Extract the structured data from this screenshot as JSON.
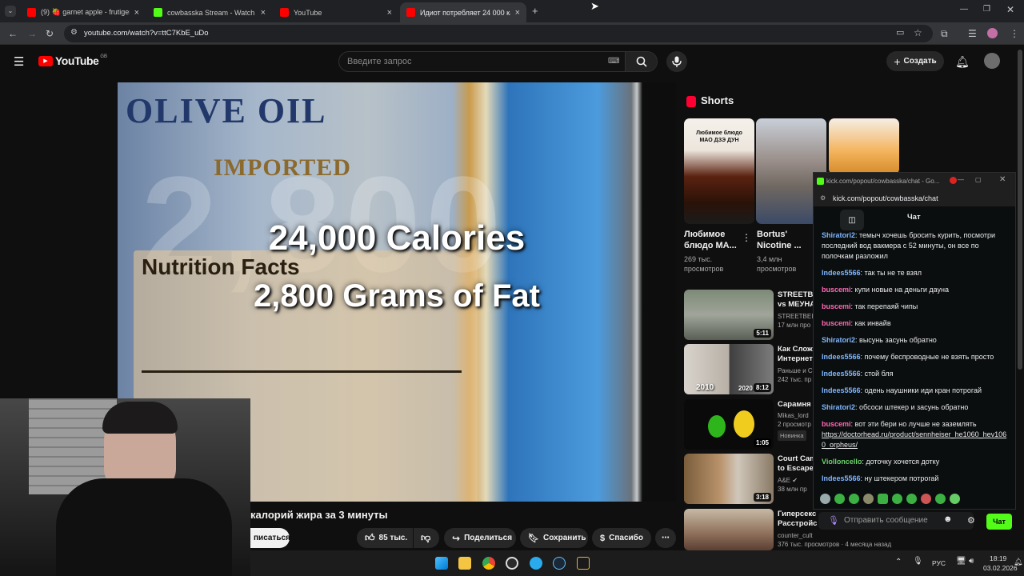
{
  "browser": {
    "tabs": [
      {
        "title": "(9) 🍓 garnet apple - frutiger a",
        "active": false
      },
      {
        "title": "cowbasska Stream - Watch Live",
        "active": false
      },
      {
        "title": "YouTube",
        "active": false
      },
      {
        "title": "Идиот потребляет 24 000 кал",
        "active": true
      }
    ],
    "new_tab": "+",
    "url": "youtube.com/watch?v=ttC7KbE_uDo"
  },
  "youtube": {
    "logo": "YouTube",
    "region": "GB",
    "search_placeholder": "Введите запрос",
    "create_label": "Создать",
    "video_overlay": {
      "line1": "24,000 Calories",
      "line2": "2,800 Grams of Fat",
      "label_top": "OLIVE OIL",
      "label_imported": "IMPORTED",
      "label_facts": "Nutrition Facts"
    },
    "video_title_fragment": "калорий жира за 3 минуты",
    "subscribe_fragment": "писаться",
    "actions": {
      "likes": "85 тыс.",
      "share": "Поделиться",
      "save": "Сохранить",
      "thanks": "Спасибо"
    },
    "shorts_heading": "Shorts",
    "shorts": [
      {
        "title_line1": "Любимое",
        "title_line2": "блюдо МА...",
        "views_line1": "269 тыс.",
        "views_line2": "просмотров",
        "thumb_text": "Любимое блюдо МАО ДЗЭ ДУН"
      },
      {
        "title_line1": "Bortus'",
        "title_line2": "Nicotine ...",
        "views_line1": "3,4 млн",
        "views_line2": "просмотров"
      }
    ],
    "recommended": [
      {
        "title1": "STREETBE",
        "title2": "vs МЕУНА",
        "meta1": "STREETBEI",
        "meta2": "17 млн про",
        "duration": "5:11"
      },
      {
        "title1": "Как Слож",
        "title2": "Интернет-",
        "meta1": "Раньше и С",
        "meta2": "242 тыс. пр",
        "duration": "8:12",
        "thumb_year": "2010",
        "thumb_year2": "2020"
      },
      {
        "title1": "Сарамня",
        "title2": "",
        "meta1": "Mikas_lord",
        "meta2": "2 просмотр",
        "badge": "Новинка",
        "duration": "1:05"
      },
      {
        "title1": "Court Cam",
        "title2": "to Escape",
        "meta1": "A&E",
        "meta2": "38 млн пр",
        "duration": "3:18"
      },
      {
        "title1": "Гиперсекс",
        "title2": "Расстройс",
        "meta1": "counter_cult",
        "meta2": "376 тыс. просмотров · 4 месяца назад"
      }
    ]
  },
  "chat_popup": {
    "window_title": "kick.com/popout/cowbasska/chat - Go...",
    "address": "kick.com/popout/cowbasska/chat",
    "tab_label": "Чат",
    "messages": [
      {
        "user": "Shiratori2",
        "color": "#7fb6ff",
        "text": "темыч хочешь бросить курить, посмотри последний вод вакмера с 52 минуты, он все по полочкам разложил"
      },
      {
        "user": "Indees5566",
        "color": "#7fb6ff",
        "text": "так ты не те взял"
      },
      {
        "user": "buscemi",
        "color": "#ff69b4",
        "text": "купи новые на деньги дауна"
      },
      {
        "user": "buscemi",
        "color": "#ff69b4",
        "text": "так перепаяй чипы"
      },
      {
        "user": "buscemi",
        "color": "#ff69b4",
        "text": "как инвайв"
      },
      {
        "user": "Shiratori2",
        "color": "#7fb6ff",
        "text": "высунь засунь обратно"
      },
      {
        "user": "Indees5566",
        "color": "#7fb6ff",
        "text": "почему беспроводные не взять просто"
      },
      {
        "user": "Indees5566",
        "color": "#7fb6ff",
        "text": "стой бля"
      },
      {
        "user": "Indees5566",
        "color": "#7fb6ff",
        "text": "одень наушники иди кран потрогай"
      },
      {
        "user": "Shiratori2",
        "color": "#7fb6ff",
        "text": "обсоси штекер и засунь обратно"
      },
      {
        "user": "buscemi",
        "color": "#ff69b4",
        "text": "вот эти бери но лучше не заземлять",
        "link": "https://doctorhead.ru/product/sennheiser_he1060_hev1060_orpheus/"
      },
      {
        "user": "Violloncello",
        "color": "#6bd36b",
        "text": "доточку хочется дотку"
      },
      {
        "user": "Indees5566",
        "color": "#7fb6ff",
        "text": "ну штекером потрогай"
      }
    ],
    "input_placeholder": "Отправить сообщение",
    "send_label": "Чат"
  },
  "taskbar": {
    "language": "РУС",
    "time": "18:19",
    "date": "03.02.2026"
  },
  "colors": {
    "kick_green": "#53fc18",
    "youtube_red": "#ff0000",
    "chrome_dark": "#202124"
  }
}
